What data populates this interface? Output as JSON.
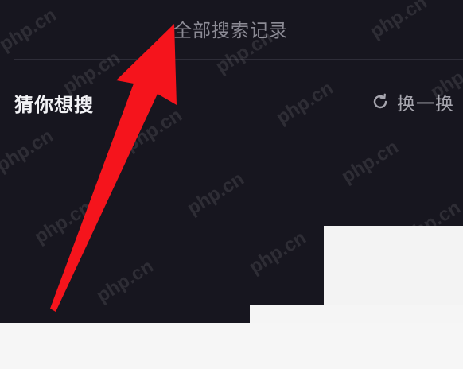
{
  "search_history": {
    "link_label": "全部搜索记录"
  },
  "suggestions": {
    "title": "猜你想搜",
    "refresh_label": "换一换",
    "refresh_icon": "refresh-icon"
  },
  "watermark": {
    "text": "php.cn"
  },
  "colors": {
    "background": "#17161f",
    "arrow": "#f5141c",
    "divider": "#2e2d38",
    "muted_text": "#8c8b95"
  }
}
